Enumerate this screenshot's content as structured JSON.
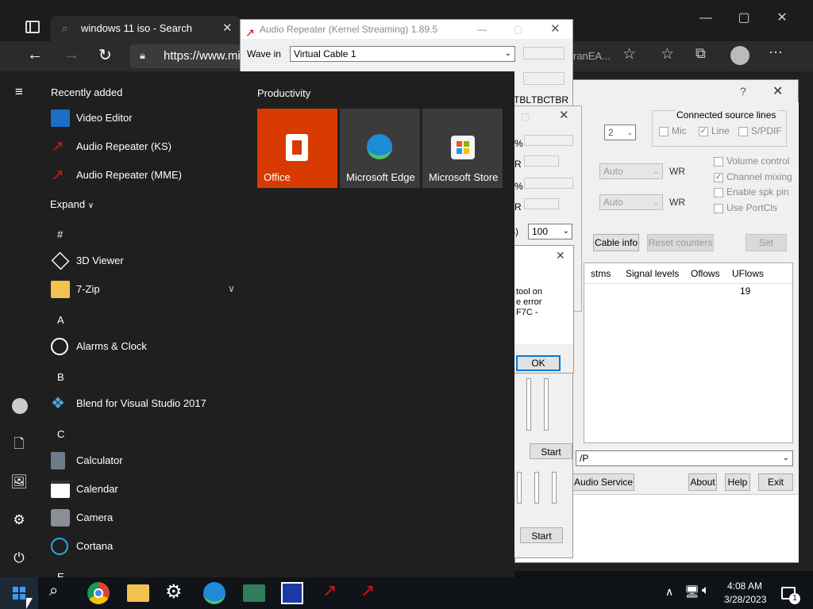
{
  "edge": {
    "tab_title": "windows 11 iso - Search",
    "url_text": "https://www.mi",
    "bg_tab_text": "ranEA..."
  },
  "audio_repeater": {
    "title": "Audio Repeater (Kernel Streaming) 1.89.5",
    "wave_in_label": "Wave in",
    "wave_in_value": "Virtual Cable 1",
    "header_cols": [
      "TBL",
      "TBC",
      "TBR"
    ],
    "pct1": "%",
    "r1": "R",
    "pct2": "%",
    "r2": "R",
    "buffers_label": "s)",
    "buffers_value": "100",
    "start_button": "Start",
    "start_button2": "Start"
  },
  "error_dialog": {
    "text_lines": [
      "tool on",
      "e error",
      "F7C -"
    ],
    "ok_button": "OK"
  },
  "host_window": {
    "help_glyph": "?",
    "connected_source_lines": "Connected source lines",
    "mic": "Mic",
    "line": "Line",
    "spdif": "S/PDIF",
    "channels_value": "2",
    "auto1": "Auto",
    "auto2": "Auto",
    "wr1": "WR",
    "wr2": "WR",
    "volume_control": "Volume control",
    "channel_mixing": "Channel mixing",
    "enable_spk_pin": "Enable spk pin",
    "use_portcls": "Use PortCls",
    "cable_info": "Cable info",
    "reset_counters": "Reset counters",
    "set": "Set",
    "table_headers": [
      "stms",
      "Signal levels",
      "Oflows",
      "UFlows"
    ],
    "uflows_value": "19",
    "combo_tail": "/P",
    "audio_service": "t Audio Service",
    "about": "About",
    "help": "Help",
    "exit": "Exit"
  },
  "start_menu": {
    "recently_added": "Recently added",
    "recent_apps": [
      "Video Editor",
      "Audio Repeater (KS)",
      "Audio Repeater (MME)"
    ],
    "expand": "Expand",
    "letter_hash": "#",
    "hash_apps": [
      "3D Viewer",
      "7-Zip"
    ],
    "letter_a": "A",
    "a_apps": [
      "Alarms & Clock"
    ],
    "letter_b": "B",
    "b_apps": [
      "Blend for Visual Studio 2017"
    ],
    "letter_c": "C",
    "c_apps": [
      "Calculator",
      "Calendar",
      "Camera",
      "Cortana"
    ],
    "letter_e": "E",
    "productivity": "Productivity",
    "tiles": [
      "Office",
      "Microsoft Edge",
      "Microsoft Store"
    ]
  },
  "taskbar": {
    "time": "4:08 AM",
    "date": "3/28/2023",
    "notification_count": "1"
  },
  "colors": {
    "office_tile": "#d83b01",
    "tile_bg": "#3b3b3b",
    "taskbar": "#101418",
    "start_bg": "#1f1f1f"
  }
}
